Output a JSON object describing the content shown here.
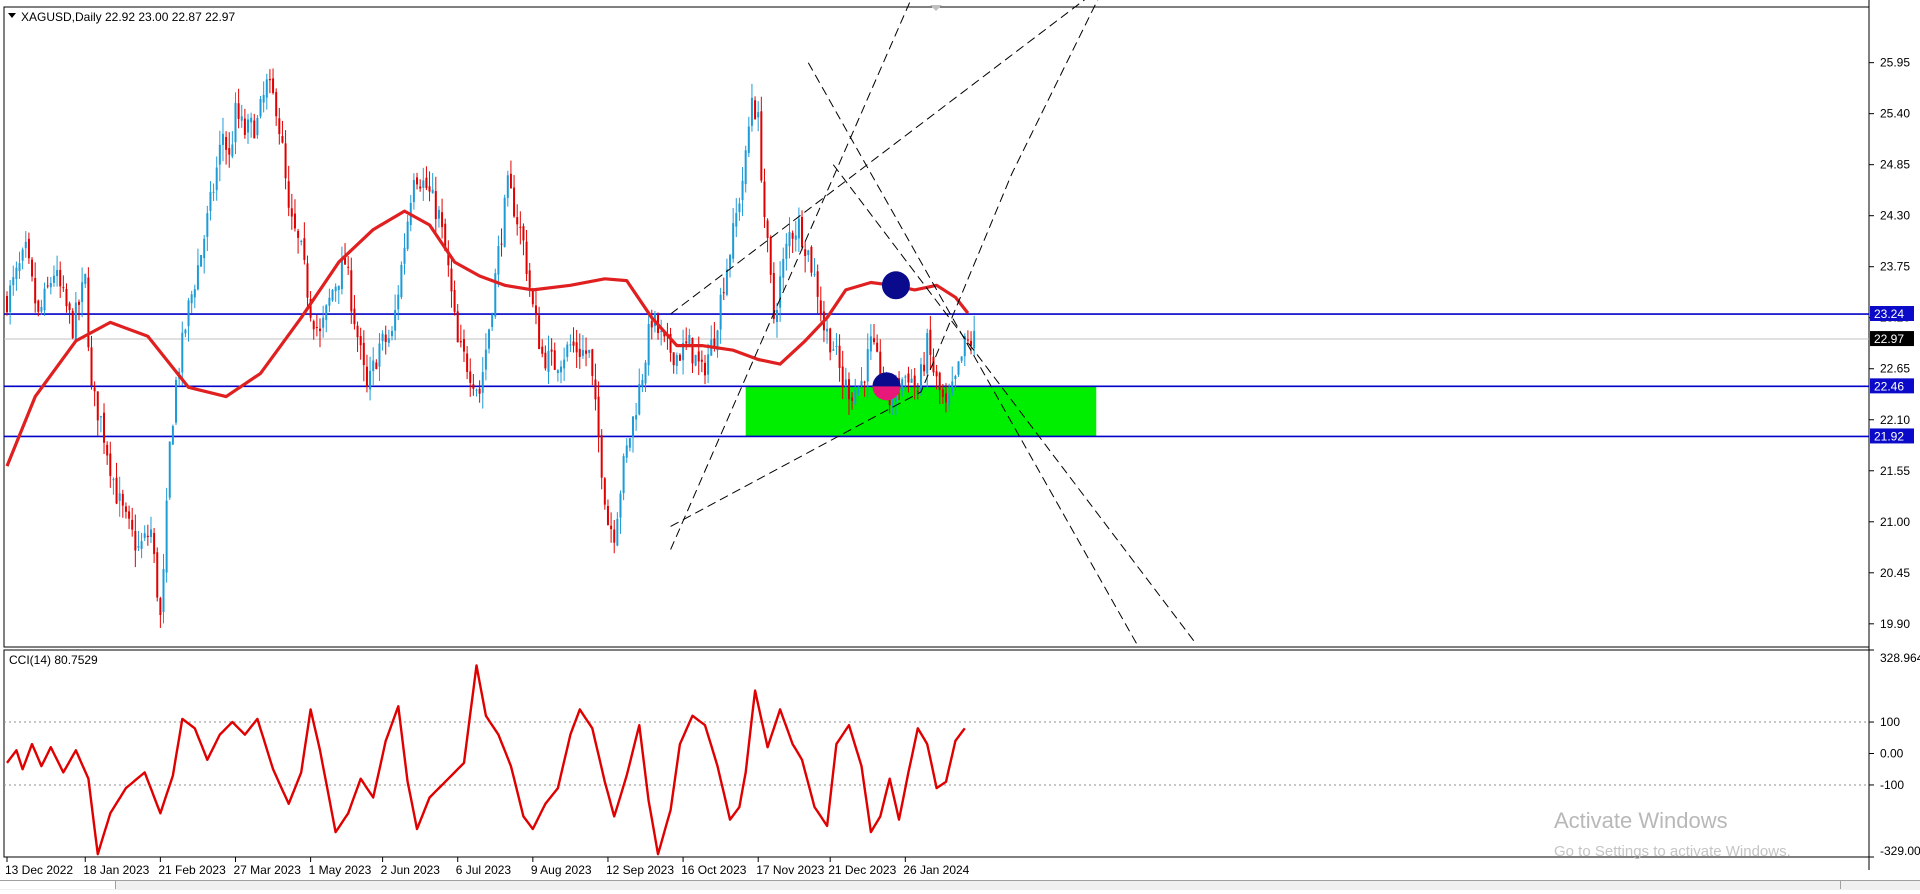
{
  "header": {
    "symbol_label": "XAGUSD,Daily",
    "ohlc_label": "22.92 23.00 22.87 22.97"
  },
  "indicator_label": "CCI(14) 80.7529",
  "watermark": {
    "line1": "Activate Windows",
    "line2": "Go to Settings to activate Windows."
  },
  "colors": {
    "bull": "#1e9bd7",
    "bear": "#e00000",
    "ma": "#e02020",
    "level": "#0000c8",
    "zone": "#00ee00",
    "dot_blue": "#0a0a8c",
    "dot_pink": "#e8187a",
    "cci": "#e00000",
    "price_tag": "#0a0ac8",
    "current_tag": "#000000"
  },
  "chart_data": [
    {
      "type": "candlestick",
      "title": "XAGUSD,Daily",
      "ylim": [
        19.65,
        26.55
      ],
      "y_ticks": [
        "25.95",
        "25.40",
        "24.85",
        "24.30",
        "23.75",
        "23.20",
        "22.65",
        "22.10",
        "21.55",
        "21.00",
        "20.45",
        "19.90"
      ],
      "x_tick_labels": [
        "13 Dec 2022",
        "18 Jan 2023",
        "21 Feb 2023",
        "27 Mar 2023",
        "1 May 2023",
        "2 Jun 2023",
        "6 Jul 2023",
        "9 Aug 2023",
        "12 Sep 2023",
        "16 Oct 2023",
        "17 Nov 2023",
        "21 Dec 2023",
        "26 Jan 2024"
      ],
      "x_tick_index": [
        0,
        25,
        49,
        73,
        97,
        120,
        144,
        168,
        192,
        216,
        240,
        263,
        287
      ],
      "bar_count": 310,
      "close_path": [
        [
          0,
          23.4
        ],
        [
          6,
          23.9
        ],
        [
          10,
          23.2
        ],
        [
          15,
          23.7
        ],
        [
          21,
          23.1
        ],
        [
          25,
          23.6
        ],
        [
          27,
          22.4
        ],
        [
          30,
          22.1
        ],
        [
          35,
          21.3
        ],
        [
          38,
          21.0
        ],
        [
          42,
          20.7
        ],
        [
          46,
          20.9
        ],
        [
          49,
          19.95
        ],
        [
          50,
          20.4
        ],
        [
          52,
          21.8
        ],
        [
          54,
          22.5
        ],
        [
          58,
          23.3
        ],
        [
          62,
          23.9
        ],
        [
          66,
          24.6
        ],
        [
          69,
          25.2
        ],
        [
          71,
          24.9
        ],
        [
          73,
          25.4
        ],
        [
          76,
          25.2
        ],
        [
          80,
          25.3
        ],
        [
          83,
          25.7
        ],
        [
          86,
          25.5
        ],
        [
          88,
          25.0
        ],
        [
          90,
          24.3
        ],
        [
          94,
          23.9
        ],
        [
          97,
          23.3
        ],
        [
          100,
          23.0
        ],
        [
          104,
          23.5
        ],
        [
          108,
          23.8
        ],
        [
          112,
          23.0
        ],
        [
          115,
          22.4
        ],
        [
          119,
          22.9
        ],
        [
          123,
          23.0
        ],
        [
          127,
          24.0
        ],
        [
          130,
          24.8
        ],
        [
          134,
          24.6
        ],
        [
          138,
          24.3
        ],
        [
          141,
          23.7
        ],
        [
          144,
          22.9
        ],
        [
          147,
          22.7
        ],
        [
          151,
          22.4
        ],
        [
          154,
          23.1
        ],
        [
          157,
          23.9
        ],
        [
          160,
          24.6
        ],
        [
          162,
          24.4
        ],
        [
          165,
          24.0
        ],
        [
          168,
          23.3
        ],
        [
          171,
          22.8
        ],
        [
          175,
          22.7
        ],
        [
          180,
          22.9
        ],
        [
          186,
          22.8
        ],
        [
          192,
          21.0
        ],
        [
          194,
          20.9
        ],
        [
          197,
          21.6
        ],
        [
          200,
          22.1
        ],
        [
          203,
          22.6
        ],
        [
          206,
          23.2
        ],
        [
          210,
          22.9
        ],
        [
          214,
          22.8
        ],
        [
          218,
          22.9
        ],
        [
          222,
          22.6
        ],
        [
          226,
          23.0
        ],
        [
          229,
          23.6
        ],
        [
          232,
          24.1
        ],
        [
          236,
          24.9
        ],
        [
          238,
          25.6
        ],
        [
          240,
          25.3
        ],
        [
          242,
          24.3
        ],
        [
          245,
          23.2
        ],
        [
          247,
          23.6
        ],
        [
          250,
          24.1
        ],
        [
          253,
          24.2
        ],
        [
          256,
          23.9
        ],
        [
          259,
          23.5
        ],
        [
          261,
          23.1
        ],
        [
          264,
          22.9
        ],
        [
          267,
          22.5
        ],
        [
          270,
          22.4
        ],
        [
          273,
          22.5
        ],
        [
          276,
          22.9
        ],
        [
          279,
          22.6
        ],
        [
          282,
          22.3
        ],
        [
          285,
          22.5
        ],
        [
          288,
          22.6
        ],
        [
          291,
          22.4
        ],
        [
          294,
          22.9
        ],
        [
          297,
          22.5
        ],
        [
          300,
          22.2
        ],
        [
          303,
          22.5
        ],
        [
          306,
          22.9
        ],
        [
          309,
          22.97
        ]
      ],
      "moving_average_path": [
        [
          0,
          21.6
        ],
        [
          9,
          22.35
        ],
        [
          22,
          22.95
        ],
        [
          33,
          23.15
        ],
        [
          45,
          23.0
        ],
        [
          58,
          22.45
        ],
        [
          70,
          22.35
        ],
        [
          81,
          22.6
        ],
        [
          94,
          23.2
        ],
        [
          106,
          23.8
        ],
        [
          117,
          24.15
        ],
        [
          127,
          24.35
        ],
        [
          135,
          24.2
        ],
        [
          143,
          23.8
        ],
        [
          151,
          23.65
        ],
        [
          159,
          23.55
        ],
        [
          168,
          23.5
        ],
        [
          180,
          23.55
        ],
        [
          191,
          23.62
        ],
        [
          198,
          23.6
        ],
        [
          206,
          23.2
        ],
        [
          214,
          22.9
        ],
        [
          222,
          22.9
        ],
        [
          232,
          22.85
        ],
        [
          240,
          22.75
        ],
        [
          247,
          22.7
        ],
        [
          255,
          22.95
        ],
        [
          262,
          23.2
        ],
        [
          268,
          23.5
        ],
        [
          276,
          23.58
        ],
        [
          283,
          23.55
        ],
        [
          290,
          23.5
        ],
        [
          297,
          23.55
        ],
        [
          303,
          23.42
        ],
        [
          307,
          23.25
        ]
      ],
      "horizontal_levels": [
        23.24,
        22.46,
        21.92
      ],
      "current_price": 22.97,
      "level_labels": [
        "23.24",
        "22.46",
        "21.92"
      ],
      "current_label": "22.97",
      "zone": {
        "x_from": 236,
        "x_to": 348,
        "y_from": 21.92,
        "y_to": 22.46
      },
      "trendlines": [
        [
          [
            212,
            20.7
          ],
          [
            291,
            26.8
          ]
        ],
        [
          [
            212,
            23.24
          ],
          [
            351,
            26.8
          ]
        ],
        [
          [
            212,
            20.95
          ],
          [
            292,
            22.4
          ],
          [
            321,
            24.75
          ],
          [
            351,
            26.8
          ]
        ],
        [
          [
            256,
            25.95
          ],
          [
            361,
            19.68
          ]
        ],
        [
          [
            264,
            24.85
          ],
          [
            380,
            19.68
          ]
        ]
      ],
      "markers": [
        {
          "x": 284,
          "y": 23.55,
          "color": "blue"
        },
        {
          "x": 281,
          "y": 22.46,
          "color": "pink"
        }
      ]
    },
    {
      "type": "line",
      "title": "CCI(14) 80.7529",
      "ylim": [
        -329.0,
        328.964
      ],
      "y_ticks": [
        "328.964",
        "100",
        "0.00",
        "-100",
        "-329.000"
      ],
      "dotted_levels": [
        100,
        -100
      ],
      "series": [
        {
          "values_path": [
            [
              0,
              -30
            ],
            [
              3,
              10
            ],
            [
              5,
              -50
            ],
            [
              8,
              30
            ],
            [
              11,
              -40
            ],
            [
              14,
              20
            ],
            [
              18,
              -60
            ],
            [
              22,
              10
            ],
            [
              26,
              -80
            ],
            [
              29,
              -320
            ],
            [
              33,
              -190
            ],
            [
              38,
              -110
            ],
            [
              44,
              -60
            ],
            [
              49,
              -190
            ],
            [
              53,
              -70
            ],
            [
              56,
              110
            ],
            [
              60,
              80
            ],
            [
              64,
              -20
            ],
            [
              68,
              60
            ],
            [
              72,
              100
            ],
            [
              76,
              60
            ],
            [
              80,
              110
            ],
            [
              85,
              -50
            ],
            [
              90,
              -160
            ],
            [
              94,
              -60
            ],
            [
              97,
              140
            ],
            [
              100,
              10
            ],
            [
              105,
              -250
            ],
            [
              109,
              -190
            ],
            [
              113,
              -80
            ],
            [
              117,
              -140
            ],
            [
              121,
              40
            ],
            [
              125,
              150
            ],
            [
              128,
              -90
            ],
            [
              131,
              -240
            ],
            [
              135,
              -140
            ],
            [
              140,
              -90
            ],
            [
              146,
              -30
            ],
            [
              150,
              280
            ],
            [
              153,
              120
            ],
            [
              157,
              60
            ],
            [
              161,
              -40
            ],
            [
              165,
              -200
            ],
            [
              168,
              -240
            ],
            [
              172,
              -160
            ],
            [
              176,
              -110
            ],
            [
              180,
              60
            ],
            [
              183,
              140
            ],
            [
              187,
              80
            ],
            [
              191,
              -90
            ],
            [
              194,
              -200
            ],
            [
              198,
              -70
            ],
            [
              202,
              90
            ],
            [
              205,
              -150
            ],
            [
              208,
              -320
            ],
            [
              212,
              -180
            ],
            [
              215,
              30
            ],
            [
              219,
              120
            ],
            [
              223,
              90
            ],
            [
              227,
              -40
            ],
            [
              231,
              -210
            ],
            [
              234,
              -170
            ],
            [
              236,
              -60
            ],
            [
              239,
              200
            ],
            [
              243,
              20
            ],
            [
              247,
              140
            ],
            [
              251,
              30
            ],
            [
              254,
              -20
            ],
            [
              258,
              -170
            ],
            [
              262,
              -230
            ],
            [
              265,
              30
            ],
            [
              269,
              90
            ],
            [
              273,
              -40
            ],
            [
              276,
              -250
            ],
            [
              279,
              -200
            ],
            [
              282,
              -80
            ],
            [
              285,
              -210
            ],
            [
              288,
              -60
            ],
            [
              291,
              80
            ],
            [
              294,
              30
            ],
            [
              297,
              -110
            ],
            [
              300,
              -90
            ],
            [
              303,
              40
            ],
            [
              306,
              80
            ]
          ]
        }
      ]
    }
  ]
}
